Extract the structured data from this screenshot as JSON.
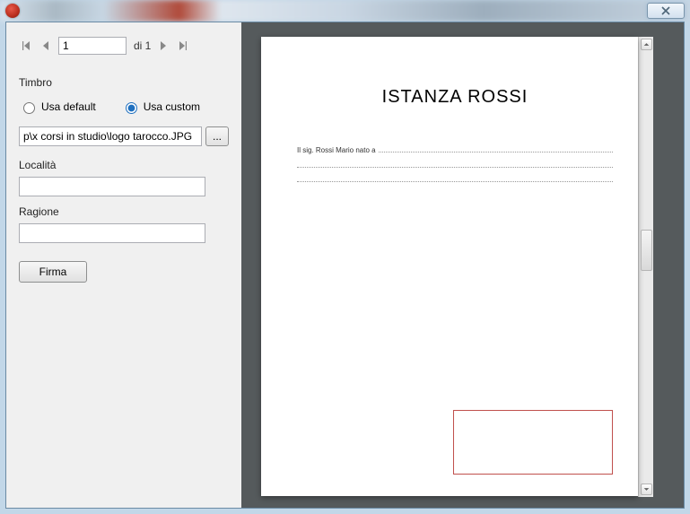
{
  "nav": {
    "current_page": "1",
    "page_of": "di 1"
  },
  "timbro": {
    "label": "Timbro",
    "use_default_label": "Usa default",
    "use_custom_label": "Usa custom",
    "selected": "custom",
    "path_value": "p\\x corsi in studio\\logo tarocco.JPG",
    "browse_label": "..."
  },
  "localita": {
    "label": "Località",
    "value": ""
  },
  "ragione": {
    "label": "Ragione",
    "value": ""
  },
  "firma_button": "Firma",
  "document": {
    "title": "ISTANZA ROSSI",
    "first_line_prefix": "Il sig. Rossi Mario nato a"
  }
}
